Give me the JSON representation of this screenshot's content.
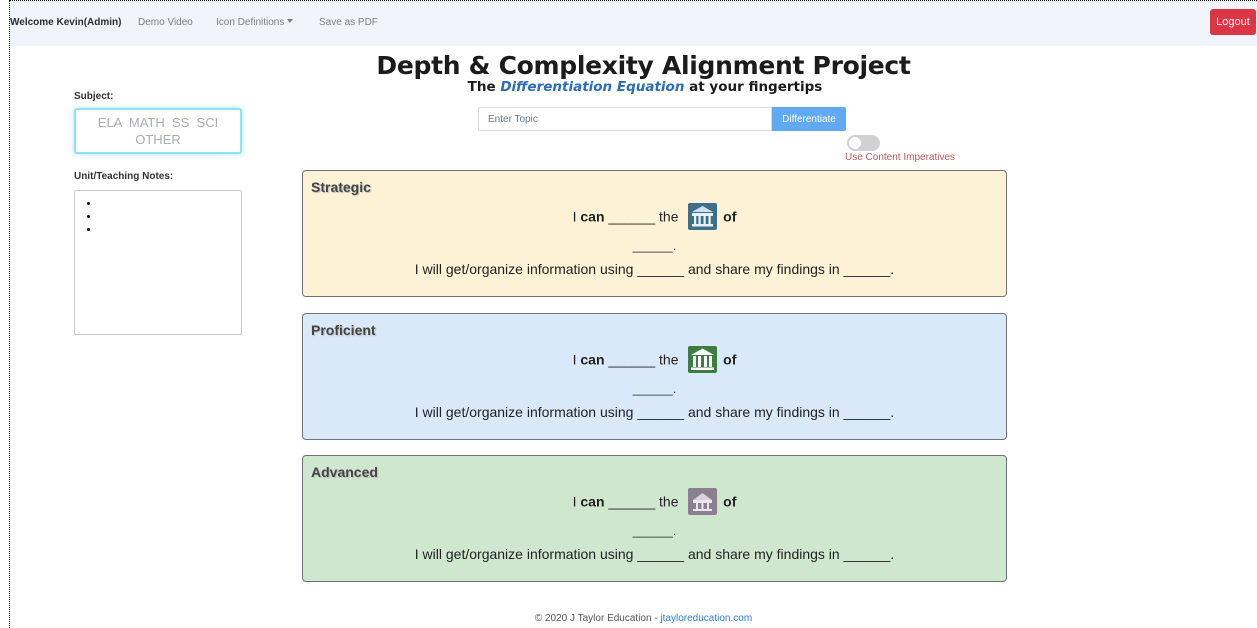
{
  "nav": {
    "welcome": "Welcome Kevin(Admin)",
    "demo_video": "Demo Video",
    "icon_definitions": "Icon Definitions",
    "save_pdf": "Save as PDF",
    "logout": "Logout"
  },
  "header": {
    "title": "Depth & Complexity Alignment Project",
    "subtitle_pre": "The ",
    "subtitle_highlight": "Differentiation Equation",
    "subtitle_post": " at your fingertips"
  },
  "subject": {
    "label": "Subject:",
    "options_line1": "ELA  MATH  SS  SCI",
    "options_line2": "OTHER"
  },
  "notes": {
    "label": "Unit/Teaching Notes:",
    "bullets": [
      "",
      "",
      ""
    ]
  },
  "topic": {
    "placeholder": "Enter Topic",
    "button": "Differentiate"
  },
  "toggle": {
    "label": "Use Content Imperatives",
    "on": false
  },
  "levels": [
    {
      "title": "Strategic",
      "i": "I ",
      "can": "can",
      "blank1": " ______ the ",
      "of": "of",
      "line2": "______.",
      "line3": "I will get/organize information using ______ and share my findings in ______.",
      "icon": "big-idea-icon",
      "icon_color": "#3e6f8a"
    },
    {
      "title": "Proficient",
      "i": "I ",
      "can": "can",
      "blank1": " ______ the ",
      "of": "of",
      "line2": "______.",
      "line3": "I will get/organize information using ______ and share my findings in ______.",
      "icon": "building-pillars-icon",
      "icon_color": "#3d7d43"
    },
    {
      "title": "Advanced",
      "i": "I ",
      "can": "can",
      "blank1": " ______ the ",
      "of": "of",
      "line2": "______.",
      "line3": "I will get/organize information using ______ and share my findings in ______.",
      "icon": "ethics-scale-icon",
      "icon_color": "#8a8090"
    }
  ],
  "footer": {
    "text": "© 2020 J Taylor Education - ",
    "link": "jtayloreducation.com"
  }
}
